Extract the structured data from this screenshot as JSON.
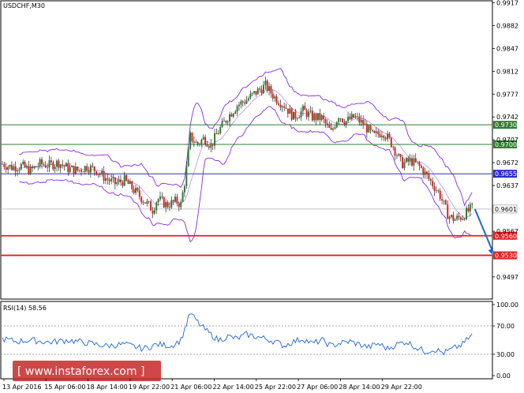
{
  "chart_data": [
    {
      "type": "candlestick",
      "title": "USDCHF,M30",
      "y_ticks": [
        0.9917,
        0.9882,
        0.9847,
        0.9812,
        0.9777,
        0.9742,
        0.9707,
        0.9672,
        0.9637,
        0.9567,
        0.9497
      ],
      "ylim": [
        0.9463,
        0.992
      ],
      "x_labels": [
        "13 Apr 2016",
        "15 Apr 06:00",
        "18 Apr 14:00",
        "19 Apr 22:00",
        "21 Apr 06:00",
        "22 Apr 14:00",
        "25 Apr 22:00",
        "27 Apr 06:00",
        "28 Apr 14:00",
        "29 Apr 22:00"
      ],
      "levels": [
        {
          "value": 0.973,
          "label": "0.9730",
          "color": "#2e7d32",
          "role": "resistance"
        },
        {
          "value": 0.97,
          "label": "0.9700",
          "color": "#2e7d32",
          "role": "resistance"
        },
        {
          "value": 0.9655,
          "label": "0.9655",
          "color": "#2c2cc8",
          "role": "pivot"
        },
        {
          "value": 0.956,
          "label": "0.9560",
          "color": "#e02020",
          "role": "support"
        },
        {
          "value": 0.953,
          "label": "0.9530",
          "color": "#e02020",
          "role": "support"
        }
      ],
      "current_price": {
        "value": 0.9601,
        "label": "0.9601"
      },
      "price_path": [
        [
          0,
          0.967
        ],
        [
          10,
          0.9665
        ],
        [
          20,
          0.9667
        ],
        [
          30,
          0.966
        ],
        [
          40,
          0.967
        ],
        [
          50,
          0.9668
        ],
        [
          60,
          0.9672
        ],
        [
          70,
          0.9663
        ],
        [
          80,
          0.966
        ],
        [
          90,
          0.9666
        ],
        [
          100,
          0.966
        ],
        [
          110,
          0.9648
        ],
        [
          120,
          0.964
        ],
        [
          130,
          0.9645
        ],
        [
          140,
          0.963
        ],
        [
          150,
          0.9615
        ],
        [
          160,
          0.96
        ],
        [
          165,
          0.9617
        ],
        [
          175,
          0.9607
        ],
        [
          185,
          0.9613
        ],
        [
          190,
          0.9608
        ],
        [
          195,
          0.965
        ],
        [
          200,
          0.9712
        ],
        [
          207,
          0.97
        ],
        [
          215,
          0.971
        ],
        [
          222,
          0.9698
        ],
        [
          230,
          0.972
        ],
        [
          240,
          0.9742
        ],
        [
          250,
          0.976
        ],
        [
          260,
          0.9768
        ],
        [
          270,
          0.978
        ],
        [
          280,
          0.979
        ],
        [
          290,
          0.9772
        ],
        [
          300,
          0.976
        ],
        [
          310,
          0.9742
        ],
        [
          320,
          0.9752
        ],
        [
          330,
          0.9742
        ],
        [
          340,
          0.974
        ],
        [
          350,
          0.9718
        ],
        [
          358,
          0.9745
        ],
        [
          365,
          0.9735
        ],
        [
          375,
          0.9742
        ],
        [
          385,
          0.973
        ],
        [
          395,
          0.9712
        ],
        [
          405,
          0.972
        ],
        [
          415,
          0.97
        ],
        [
          425,
          0.967
        ],
        [
          435,
          0.9675
        ],
        [
          445,
          0.9665
        ],
        [
          455,
          0.9645
        ],
        [
          465,
          0.9625
        ],
        [
          475,
          0.959
        ],
        [
          482,
          0.9585
        ],
        [
          490,
          0.959
        ],
        [
          500,
          0.9603
        ]
      ],
      "forecast_arrow": {
        "from": [
          503,
          0.9601
        ],
        "to": [
          522,
          0.9531
        ],
        "color": "#1e66d6"
      }
    },
    {
      "type": "line",
      "title": "RSI(14) 58.56",
      "y_ticks": [
        100.0,
        70.0,
        30.0,
        0.0
      ],
      "ylim": [
        0,
        100
      ],
      "dotted_levels": [
        70,
        30
      ],
      "series": [
        {
          "color": "#1e66d6",
          "values": [
            [
              0,
              52
            ],
            [
              15,
              48
            ],
            [
              30,
              50
            ],
            [
              50,
              47
            ],
            [
              70,
              50
            ],
            [
              90,
              46
            ],
            [
              110,
              42
            ],
            [
              130,
              44
            ],
            [
              150,
              38
            ],
            [
              165,
              44
            ],
            [
              180,
              42
            ],
            [
              190,
              50
            ],
            [
              200,
              88
            ],
            [
              210,
              72
            ],
            [
              220,
              60
            ],
            [
              230,
              50
            ],
            [
              240,
              55
            ],
            [
              250,
              52
            ],
            [
              260,
              58
            ],
            [
              270,
              55
            ],
            [
              280,
              52
            ],
            [
              290,
              48
            ],
            [
              300,
              42
            ],
            [
              310,
              48
            ],
            [
              320,
              52
            ],
            [
              330,
              45
            ],
            [
              340,
              50
            ],
            [
              350,
              42
            ],
            [
              360,
              46
            ],
            [
              370,
              48
            ],
            [
              380,
              44
            ],
            [
              390,
              40
            ],
            [
              400,
              45
            ],
            [
              410,
              38
            ],
            [
              420,
              44
            ],
            [
              430,
              48
            ],
            [
              440,
              40
            ],
            [
              450,
              34
            ],
            [
              460,
              37
            ],
            [
              470,
              32
            ],
            [
              480,
              38
            ],
            [
              490,
              44
            ],
            [
              500,
              58.56
            ]
          ]
        }
      ]
    }
  ],
  "watermark": "[ www.instaforex.com ]",
  "colors": {
    "candle_up": "#2e7d32",
    "candle_down": "#e02020",
    "bands": "#8a2be2"
  }
}
